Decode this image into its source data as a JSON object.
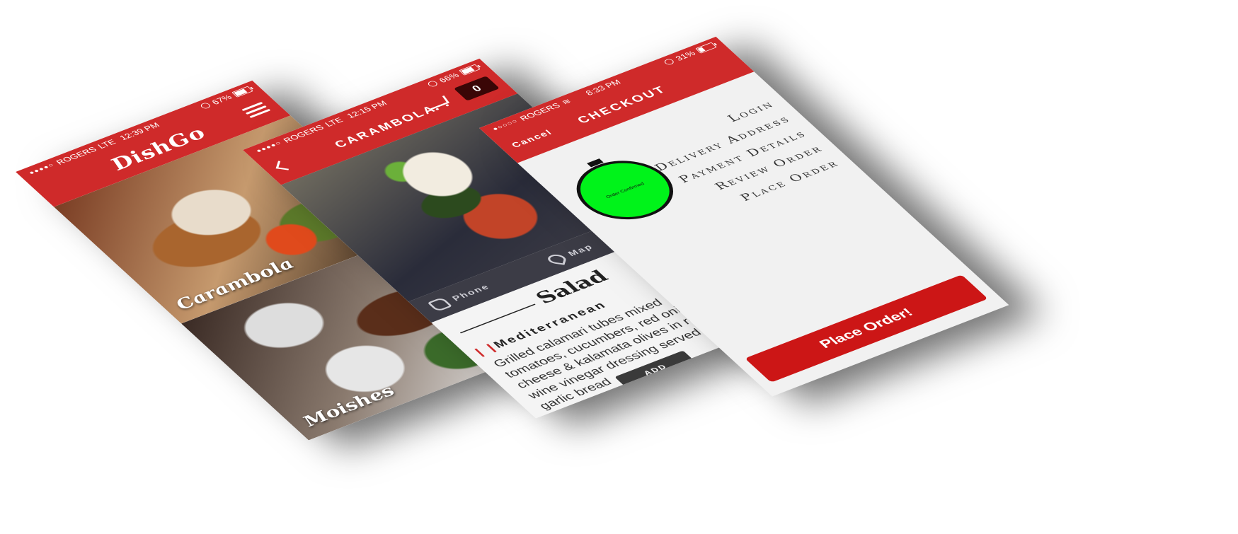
{
  "screen_list": {
    "status": {
      "carrier": "ROGERS",
      "network": "LTE",
      "time": "12:39 PM",
      "battery": "67%"
    },
    "logo": "DishGo",
    "restaurants": [
      {
        "name": "Carambola"
      },
      {
        "name": "Moishes"
      }
    ]
  },
  "screen_detail": {
    "status": {
      "carrier": "ROGERS",
      "network": "LTE",
      "time": "12:15 PM",
      "battery": "66%"
    },
    "title": "Carambola",
    "cart_count": "0",
    "actions": {
      "phone": "Phone",
      "map": "Map"
    },
    "section": "Salad",
    "dish": {
      "name": "Mediterranean",
      "description": "Grilled calamari tubes mixed tomatoes, cucumbers, red onions, cheese & kalamata olives in red wine vinegar dressing served with garlic bread",
      "add_label": "ADD"
    }
  },
  "screen_checkout": {
    "status": {
      "carrier": "ROGERS",
      "time": "8:33 PM",
      "battery": "31%"
    },
    "cancel_label": "Cancel",
    "title": "Checkout",
    "timer_label": "Order Confirmed",
    "steps": [
      {
        "label": "Login",
        "done": true
      },
      {
        "label": "Delivery Address",
        "done": true
      },
      {
        "label": "Payment Details",
        "done": true
      },
      {
        "label": "Review Order",
        "done": true
      },
      {
        "label": "Place Order",
        "done": false
      }
    ],
    "place_order_label": "Place Order!"
  },
  "colors": {
    "brand_red": "#cf2a2a",
    "button_red": "#cc1616",
    "timer_green": "#00f31a",
    "check_green": "#00e400",
    "dark_bar": "#3c3c46"
  }
}
